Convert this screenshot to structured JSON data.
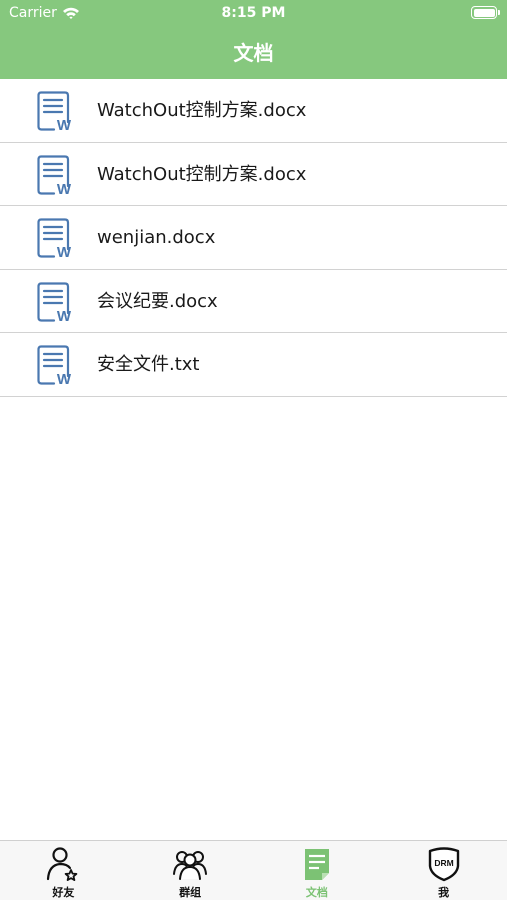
{
  "status_bar": {
    "carrier": "Carrier",
    "time": "8:15 PM"
  },
  "header": {
    "title": "文档"
  },
  "documents": [
    {
      "name": "WatchOut控制方案.docx",
      "icon": "word-document-icon"
    },
    {
      "name": "WatchOut控制方案.docx",
      "icon": "word-document-icon"
    },
    {
      "name": "wenjian.docx",
      "icon": "word-document-icon"
    },
    {
      "name": "会议纪要.docx",
      "icon": "word-document-icon"
    },
    {
      "name": "安全文件.txt",
      "icon": "word-document-icon"
    }
  ],
  "tab_bar": {
    "tabs": [
      {
        "label": "好友",
        "icon": "friend-star-icon",
        "active": false
      },
      {
        "label": "群组",
        "icon": "group-icon",
        "active": false
      },
      {
        "label": "文档",
        "icon": "document-icon",
        "active": true
      },
      {
        "label": "我",
        "icon": "drm-shield-icon",
        "active": false
      }
    ]
  },
  "colors": {
    "accent": "#86c87e",
    "active_tab": "#7cc274",
    "doc_icon_blue": "#4a78b0"
  }
}
